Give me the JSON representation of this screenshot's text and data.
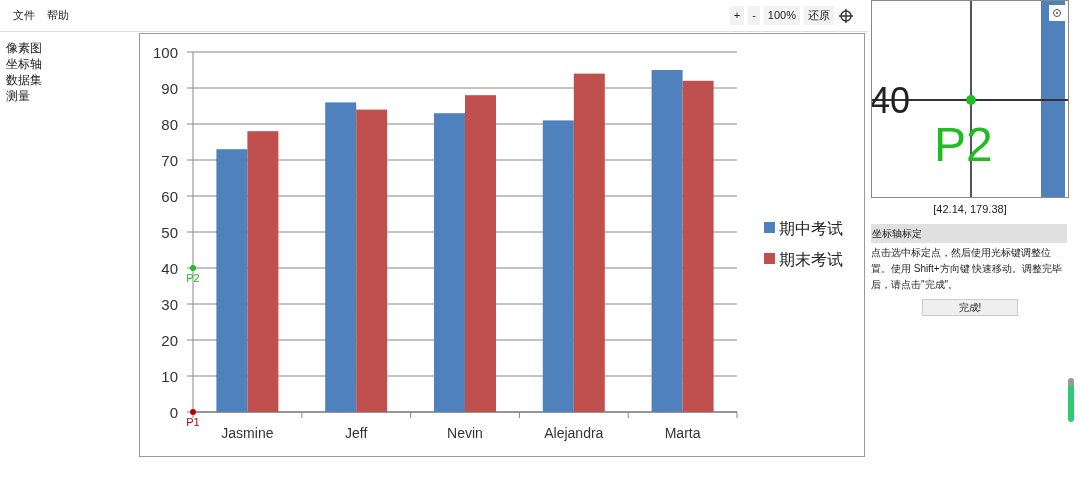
{
  "menu": [
    "文件",
    "帮助"
  ],
  "toolbar": {
    "buttons": [
      "+",
      "-",
      "100%",
      "还原"
    ]
  },
  "sidebar": {
    "items": [
      "像素图",
      "坐标轴",
      "数据集",
      "测量"
    ]
  },
  "chart_data": {
    "type": "bar",
    "categories": [
      "Jasmine",
      "Jeff",
      "Nevin",
      "Alejandra",
      "Marta"
    ],
    "series": [
      {
        "name": "期中考试",
        "color": "#4f81bd",
        "values": [
          73,
          86,
          83,
          81,
          95
        ]
      },
      {
        "name": "期末考试",
        "color": "#c0504d",
        "values": [
          78,
          84,
          88,
          94,
          92
        ]
      }
    ],
    "ylim": [
      0,
      100
    ],
    "yticks": [
      0,
      10,
      20,
      30,
      40,
      50,
      60,
      70,
      80,
      90,
      100
    ],
    "grid": true,
    "legend": true
  },
  "calibration_points": [
    {
      "label": "P2",
      "value": "40",
      "color": "#22bb22"
    },
    {
      "label": "P1",
      "value": "0",
      "color": "#c00000"
    }
  ],
  "magnifier": {
    "tick_label": "40",
    "point_label": "P2",
    "coordinates": "[42.14, 179.38]"
  },
  "panel": {
    "title": "坐标轴标定",
    "instructions": "点击选中标定点，然后使用光标键调整位置。使用 Shift+方向键 快速移动。调整完毕后，请点击\"完成\"。",
    "button": "完成!"
  }
}
